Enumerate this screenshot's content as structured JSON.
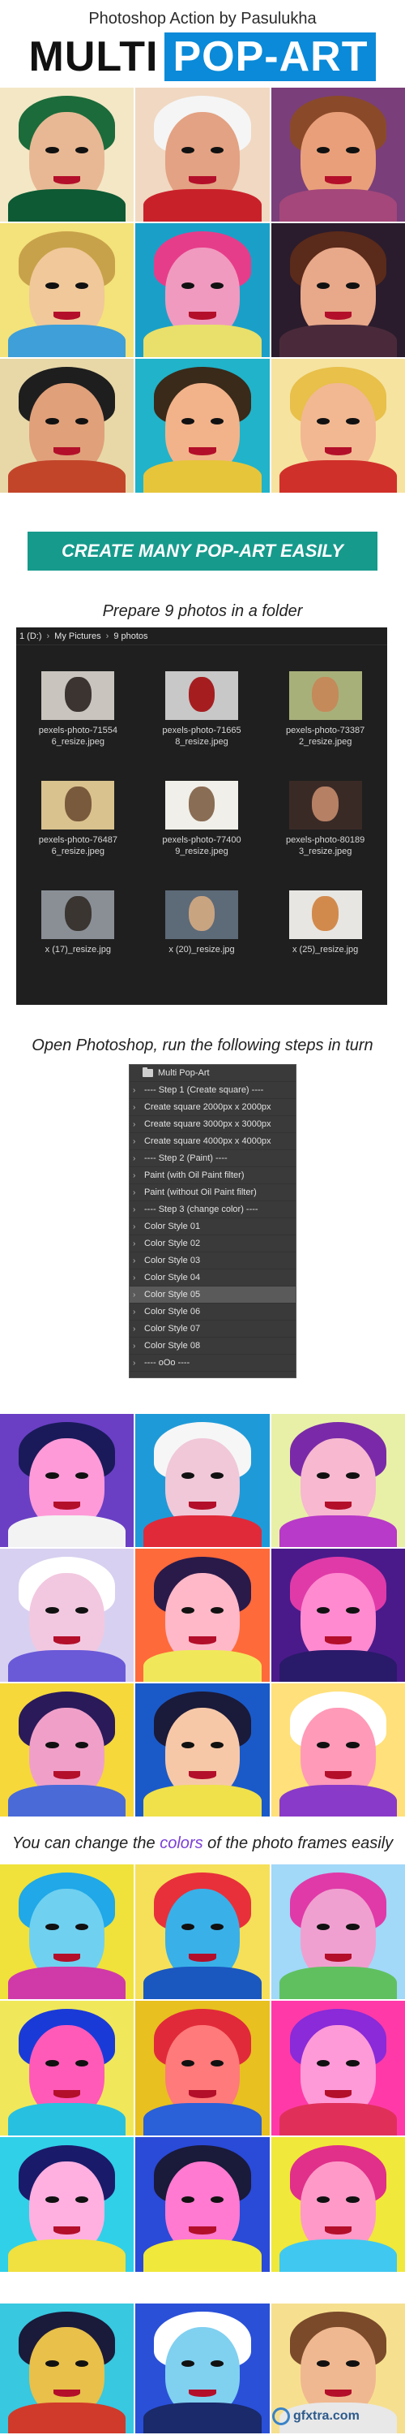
{
  "header": {
    "subtitle": "Photoshop Action by Pasulukha",
    "title_part1": "MULTI",
    "title_part2": "POP-ART"
  },
  "banner": {
    "text": "CREATE MANY POP-ART EASILY"
  },
  "caption_folder": "Prepare 9 photos in a folder",
  "explorer": {
    "breadcrumb": [
      "1 (D:)",
      "My Pictures",
      "9 photos"
    ],
    "files": [
      {
        "name": "pexels-photo-715546_resize.jpeg",
        "bg": "#c9c4be",
        "fg": "#3b3431"
      },
      {
        "name": "pexels-photo-716658_resize.jpeg",
        "bg": "#c8c8c8",
        "fg": "#a61d20"
      },
      {
        "name": "pexels-photo-733872_resize.jpeg",
        "bg": "#a8b07a",
        "fg": "#c48a5a"
      },
      {
        "name": "pexels-photo-764876_resize.jpeg",
        "bg": "#d9c28e",
        "fg": "#7a5a3c"
      },
      {
        "name": "pexels-photo-774009_resize.jpeg",
        "bg": "#f0efe9",
        "fg": "#8a6d55"
      },
      {
        "name": "pexels-photo-801893_resize.jpeg",
        "bg": "#3a2a26",
        "fg": "#b68064"
      },
      {
        "name": "x (17)_resize.jpg",
        "bg": "#8a8f96",
        "fg": "#3a3531"
      },
      {
        "name": "x (20)_resize.jpg",
        "bg": "#5d6a78",
        "fg": "#c9a481"
      },
      {
        "name": "x (25)_resize.jpg",
        "bg": "#e8e6e2",
        "fg": "#d28a4c"
      }
    ]
  },
  "caption_photoshop": "Open Photoshop, run the following steps in turn",
  "actions": {
    "folder": "Multi Pop-Art",
    "rows": [
      {
        "label": "---- Step 1 (Create square) ----",
        "selected": false
      },
      {
        "label": "Create square 2000px x 2000px",
        "selected": false
      },
      {
        "label": "Create square 3000px x 3000px",
        "selected": false
      },
      {
        "label": "Create square 4000px x 4000px",
        "selected": false
      },
      {
        "label": "---- Step 2 (Paint) ----",
        "selected": false
      },
      {
        "label": "Paint (with Oil Paint filter)",
        "selected": false
      },
      {
        "label": "Paint (without Oil Paint filter)",
        "selected": false
      },
      {
        "label": "---- Step 3 (change color) ----",
        "selected": false
      },
      {
        "label": "Color Style 01",
        "selected": false
      },
      {
        "label": "Color Style 02",
        "selected": false
      },
      {
        "label": "Color Style 03",
        "selected": false
      },
      {
        "label": "Color Style 04",
        "selected": false
      },
      {
        "label": "Color Style 05",
        "selected": true
      },
      {
        "label": "Color Style 06",
        "selected": false
      },
      {
        "label": "Color Style 07",
        "selected": false
      },
      {
        "label": "Color Style 08",
        "selected": false
      },
      {
        "label": "---- oOo ----",
        "selected": false
      }
    ]
  },
  "caption_colors": {
    "before": "You can change the ",
    "highlight": "colors",
    "after": " of the photo frames easily"
  },
  "watermark": "gfxtra.com",
  "grid1": [
    {
      "bg": "#f3e7c6",
      "hair": "#1c6b3a",
      "face": "#e8b894",
      "body": "#0d5a34"
    },
    {
      "bg": "#f0d8c2",
      "hair": "#f5f5f5",
      "face": "#e3a283",
      "body": "#c9212a"
    },
    {
      "bg": "#7a3e7a",
      "hair": "#8a4a2a",
      "face": "#e9a07a",
      "body": "#a5477a"
    },
    {
      "bg": "#f4e27a",
      "hair": "#c8a24a",
      "face": "#f0c89a",
      "body": "#3f9fd8"
    },
    {
      "bg": "#1aa0c8",
      "hair": "#e63d8a",
      "face": "#f09abf",
      "body": "#e8e06a"
    },
    {
      "bg": "#2a1c2c",
      "hair": "#5a2a1a",
      "face": "#e8a88a",
      "body": "#4a2a3a"
    },
    {
      "bg": "#e8d8a8",
      "hair": "#1e1e1e",
      "face": "#e0a07a",
      "body": "#c2452a"
    },
    {
      "bg": "#21b3c9",
      "hair": "#3a2a1a",
      "face": "#f2b38a",
      "body": "#e7c53a"
    },
    {
      "bg": "#f6e3a0",
      "hair": "#e8c04a",
      "face": "#f2b892",
      "body": "#d0302a"
    }
  ],
  "grid2": [
    {
      "bg": "#6a3fc4",
      "hair": "#1a1a5a",
      "face": "#ff9ad8",
      "body": "#f3f3f3"
    },
    {
      "bg": "#1f9ad8",
      "hair": "#f6f6f6",
      "face": "#f0c8d8",
      "body": "#e02a3a"
    },
    {
      "bg": "#e8f0a8",
      "hair": "#7a2aa8",
      "face": "#f7b8d0",
      "body": "#b83ac8"
    },
    {
      "bg": "#d8d0f0",
      "hair": "#ffffff",
      "face": "#f2c8e0",
      "body": "#6a5ad8"
    },
    {
      "bg": "#ff6a3a",
      "hair": "#2a1a4a",
      "face": "#ffb8c8",
      "body": "#f0e85a"
    },
    {
      "bg": "#4a1a8a",
      "hair": "#e03aa8",
      "face": "#ff8ad0",
      "body": "#2a1a6a"
    },
    {
      "bg": "#f6d83a",
      "hair": "#2a1a5a",
      "face": "#f0a0c8",
      "body": "#4a6ad8"
    },
    {
      "bg": "#1a5ac8",
      "hair": "#1a1a3a",
      "face": "#f7c8a8",
      "body": "#f0e04a"
    },
    {
      "bg": "#ffe07a",
      "hair": "#ffffff",
      "face": "#ff9ab8",
      "body": "#8a3ac8"
    }
  ],
  "grid3": [
    {
      "bg": "#f0e23a",
      "hair": "#20a8e8",
      "face": "#70d0f0",
      "body": "#d03aa8"
    },
    {
      "bg": "#f6e05a",
      "hair": "#e8303a",
      "face": "#3ab0e8",
      "body": "#1a58c0"
    },
    {
      "bg": "#a2d8f8",
      "hair": "#e03aa8",
      "face": "#f0a0d0",
      "body": "#60c060"
    },
    {
      "bg": "#f0e85a",
      "hair": "#1a3ad8",
      "face": "#ff5ab8",
      "body": "#28c0e0"
    },
    {
      "bg": "#e8c020",
      "hair": "#e02a3a",
      "face": "#ff7a7a",
      "body": "#2a60d8"
    },
    {
      "bg": "#ff3aa8",
      "hair": "#8a2ad8",
      "face": "#ff9ad8",
      "body": "#e0305a"
    },
    {
      "bg": "#30d0e8",
      "hair": "#1a1a6a",
      "face": "#ffb0e0",
      "body": "#f0e040"
    },
    {
      "bg": "#2a4ad8",
      "hair": "#1a1a3a",
      "face": "#ff7ad0",
      "body": "#f0e83a"
    },
    {
      "bg": "#f0e83a",
      "hair": "#e0308a",
      "face": "#ff9ac8",
      "body": "#40c8f0"
    }
  ],
  "grid4": [
    {
      "bg": "#38c8e0",
      "hair": "#1a1a3a",
      "face": "#e8c04a",
      "body": "#d03a2a"
    },
    {
      "bg": "#2a50d8",
      "hair": "#ffffff",
      "face": "#80d0f0",
      "body": "#1a2a6a"
    },
    {
      "bg": "#f6e090",
      "hair": "#7a4a2a",
      "face": "#f0b890",
      "body": "#e8e8e8"
    }
  ]
}
